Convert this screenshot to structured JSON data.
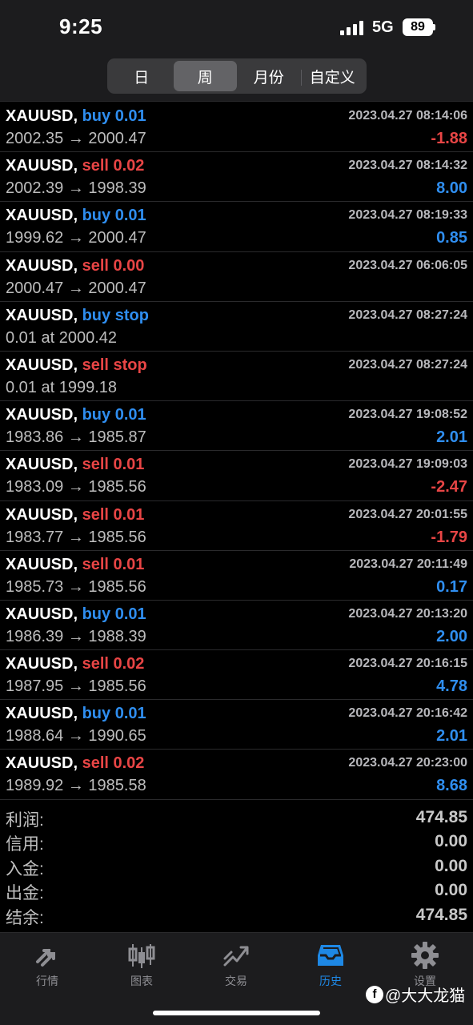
{
  "status": {
    "time": "9:25",
    "network": "5G",
    "battery": "89"
  },
  "segments": {
    "day": "日",
    "week": "周",
    "month": "月份",
    "custom": "自定义"
  },
  "orders": [
    {
      "symbol": "XAUUSD,",
      "type": "buy 0.01",
      "time": "2023.04.27 08:14:06",
      "prices": "2002.35 → 2000.47",
      "profit": "-1.88"
    },
    {
      "symbol": "XAUUSD,",
      "type": "sell 0.02",
      "time": "2023.04.27 08:14:32",
      "prices": "2002.39 → 1998.39",
      "profit": "8.00"
    },
    {
      "symbol": "XAUUSD,",
      "type": "buy 0.01",
      "time": "2023.04.27 08:19:33",
      "prices": "1999.62 → 2000.47",
      "profit": "0.85"
    },
    {
      "symbol": "XAUUSD,",
      "type": "sell 0.00",
      "time": "2023.04.27 06:06:05",
      "prices": "2000.47 → 2000.47",
      "profit": ""
    },
    {
      "symbol": "XAUUSD,",
      "type": "buy stop",
      "time": "2023.04.27 08:27:24",
      "prices": "0.01 at 2000.42",
      "profit": ""
    },
    {
      "symbol": "XAUUSD,",
      "type": "sell stop",
      "time": "2023.04.27 08:27:24",
      "prices": "0.01 at 1999.18",
      "profit": ""
    },
    {
      "symbol": "XAUUSD,",
      "type": "buy 0.01",
      "time": "2023.04.27 19:08:52",
      "prices": "1983.86 → 1985.87",
      "profit": "2.01"
    },
    {
      "symbol": "XAUUSD,",
      "type": "sell 0.01",
      "time": "2023.04.27 19:09:03",
      "prices": "1983.09 → 1985.56",
      "profit": "-2.47"
    },
    {
      "symbol": "XAUUSD,",
      "type": "sell 0.01",
      "time": "2023.04.27 20:01:55",
      "prices": "1983.77 → 1985.56",
      "profit": "-1.79"
    },
    {
      "symbol": "XAUUSD,",
      "type": "sell 0.01",
      "time": "2023.04.27 20:11:49",
      "prices": "1985.73 → 1985.56",
      "profit": "0.17"
    },
    {
      "symbol": "XAUUSD,",
      "type": "buy 0.01",
      "time": "2023.04.27 20:13:20",
      "prices": "1986.39 → 1988.39",
      "profit": "2.00"
    },
    {
      "symbol": "XAUUSD,",
      "type": "sell 0.02",
      "time": "2023.04.27 20:16:15",
      "prices": "1987.95 → 1985.56",
      "profit": "4.78"
    },
    {
      "symbol": "XAUUSD,",
      "type": "buy 0.01",
      "time": "2023.04.27 20:16:42",
      "prices": "1988.64 → 1990.65",
      "profit": "2.01"
    },
    {
      "symbol": "XAUUSD,",
      "type": "sell 0.02",
      "time": "2023.04.27 20:23:00",
      "prices": "1989.92 → 1985.58",
      "profit": "8.68"
    }
  ],
  "summary": {
    "profit_label": "利润:",
    "profit_value": "474.85",
    "credit_label": "信用:",
    "credit_value": "0.00",
    "deposit_label": "入金:",
    "deposit_value": "0.00",
    "withdrawal_label": "出金:",
    "withdrawal_value": "0.00",
    "balance_label": "结余:",
    "balance_value": "474.85"
  },
  "tabs": {
    "quotes": "行情",
    "chart": "图表",
    "trade": "交易",
    "history": "历史",
    "settings": "设置"
  },
  "watermark": "@大大龙猫",
  "colors": {
    "buy": "#2f8ef0",
    "sell": "#e84545",
    "active_tab": "#1e88e5"
  }
}
